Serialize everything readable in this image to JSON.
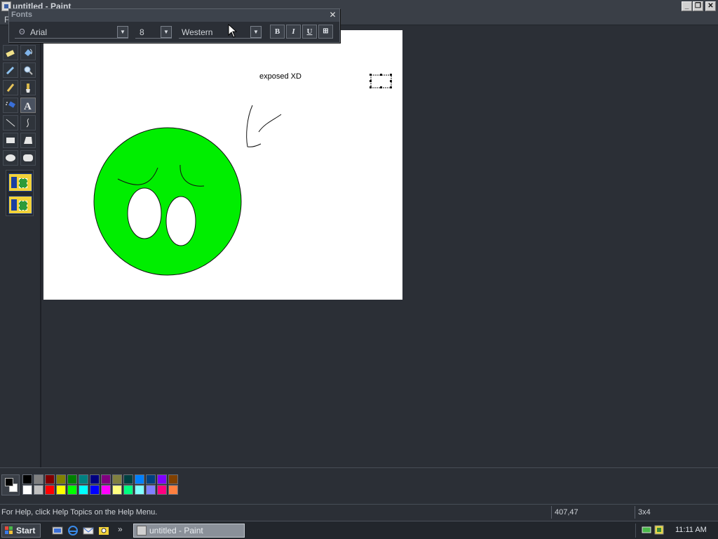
{
  "window": {
    "title": "untitled - Paint",
    "minimize": "_",
    "restore": "❐",
    "close": "✕"
  },
  "menu": {
    "file": "F"
  },
  "fonts_toolbar": {
    "title": "Fonts",
    "close": "✕",
    "font_name": "Arial",
    "font_size": "8",
    "script": "Western",
    "bold": "B",
    "italic": "I",
    "underline": "U",
    "vertical": "⊞"
  },
  "canvas": {
    "text": "exposed XD",
    "face_color": "#00ee00"
  },
  "tools": [
    {
      "name": "free-form-select",
      "icon": "eraser-icon"
    },
    {
      "name": "fill",
      "icon": "fill-bucket-icon"
    },
    {
      "name": "pick-color",
      "icon": "eyedropper-icon"
    },
    {
      "name": "magnifier",
      "icon": "magnifier-icon"
    },
    {
      "name": "pencil",
      "icon": "pencil-icon"
    },
    {
      "name": "brush",
      "icon": "brush-icon"
    },
    {
      "name": "airbrush",
      "icon": "airbrush-icon"
    },
    {
      "name": "text",
      "icon": "text-icon"
    },
    {
      "name": "line",
      "icon": "line-icon"
    },
    {
      "name": "curve",
      "icon": "curve-icon"
    },
    {
      "name": "rectangle",
      "icon": "rectangle-icon"
    },
    {
      "name": "polygon",
      "icon": "polygon-icon"
    },
    {
      "name": "ellipse",
      "icon": "ellipse-icon"
    },
    {
      "name": "rounded-rectangle",
      "icon": "rounded-rect-icon"
    }
  ],
  "palette": {
    "foreground": "#000000",
    "background": "#ffffff",
    "top_row": [
      "#000000",
      "#808080",
      "#800000",
      "#808000",
      "#008000",
      "#008080",
      "#000080",
      "#800080",
      "#808040",
      "#004040",
      "#0080ff",
      "#004080",
      "#8000ff",
      "#804000"
    ],
    "bottom_row": [
      "#ffffff",
      "#c0c0c0",
      "#ff0000",
      "#ffff00",
      "#00ff00",
      "#00ffff",
      "#0000ff",
      "#ff00ff",
      "#ffff80",
      "#00ff80",
      "#80ffff",
      "#8080ff",
      "#ff0080",
      "#ff8040"
    ]
  },
  "status": {
    "help": "For Help, click Help Topics on the Help Menu.",
    "coords": "407,47",
    "size": "3x4"
  },
  "taskbar": {
    "start": "Start",
    "more": "»",
    "task_paint": "untitled - Paint",
    "clock": "11:11 AM"
  }
}
